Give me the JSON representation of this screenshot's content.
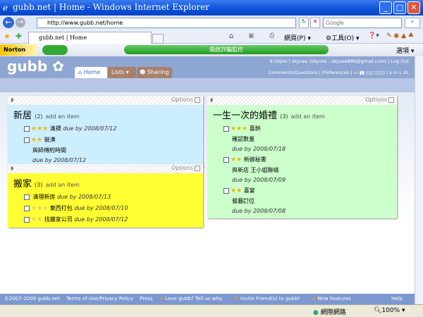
{
  "window": {
    "title": "gubb.net | Home - Windows Internet Explorer"
  },
  "browser": {
    "url": "http://www.gubb.net/home",
    "search_placeholder": "Google",
    "tab": "gubb.net | Home",
    "page_menu": "網頁(P)",
    "tools_menu": "工具(O)",
    "norton": "Norton",
    "norton_bar": "開啟詐騙監控",
    "options_menu": "選項"
  },
  "header": {
    "logo": "gubb",
    "time": "9:20pm",
    "user": "skyvee (skyvee - skyvee886@gmail.com)",
    "logout": "Log Out",
    "comments": "Comments/Questions",
    "preferences": "Preferences",
    "sizes": "s m L XL",
    "tabs": [
      "Home",
      "Lists",
      "Sharing"
    ]
  },
  "lists": [
    {
      "title": "新居",
      "count": "(2)",
      "add": "add an item",
      "options": "Options",
      "color": "#cdeeff",
      "items": [
        {
          "stars": 3,
          "faded": false,
          "name": "清掃",
          "due": "due by 2008/07/12",
          "note": ""
        },
        {
          "stars": 2,
          "faded": false,
          "name": "裝潢",
          "note": "與師傅約時間",
          "due": "due by 2008/07/12"
        }
      ]
    },
    {
      "title": "搬家",
      "count": "(3)",
      "add": "add an item",
      "options": "Options",
      "color": "#ffff33",
      "items": [
        {
          "stars": 0,
          "faded": true,
          "name": "清理新房",
          "due": "due by 2008/07/13",
          "note": ""
        },
        {
          "stars": 3,
          "faded": true,
          "name": "東西打包",
          "due": "due by 2008/07/10",
          "note": ""
        },
        {
          "stars": 2,
          "faded": true,
          "name": "找搬家公司",
          "due": "due by 2008/07/12",
          "note": ""
        }
      ]
    },
    {
      "title": "一生一次的婚禮",
      "count": "(3)",
      "add": "add an item",
      "options": "Options",
      "color": "#ccffcc",
      "items": [
        {
          "stars": 3,
          "faded": false,
          "name": "喜餅",
          "note": "確認數量",
          "due": "due by 2008/07/18"
        },
        {
          "stars": 2,
          "faded": false,
          "name": "新娘秘書",
          "note": "與新店 王小姐聯絡",
          "due": "due by 2008/07/09"
        },
        {
          "stars": 2,
          "faded": false,
          "name": "喜宴",
          "note": "餐廳訂位",
          "due": "due by 2008/07/08"
        }
      ]
    }
  ],
  "footer": {
    "copyright": "©2007-2008 gubb.net",
    "terms": "Terms of Use/Privacy Policy",
    "press": "Press",
    "love": "Love gubb? Tell us why.",
    "invite": "Invite Friend(s) to gubb!",
    "features": "New Features",
    "help": "Help"
  },
  "status": {
    "zone": "網際網路",
    "zoom": "100%"
  }
}
